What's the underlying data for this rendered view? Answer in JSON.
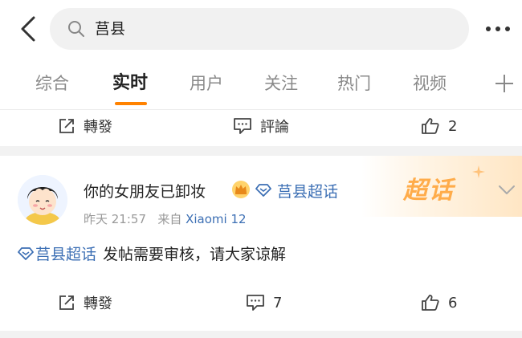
{
  "header": {
    "search_query": "莒县"
  },
  "tabs": [
    {
      "label": "综合"
    },
    {
      "label": "实时"
    },
    {
      "label": "用户"
    },
    {
      "label": "关注"
    },
    {
      "label": "热门"
    },
    {
      "label": "视频"
    }
  ],
  "active_tab": "实时",
  "accent_color": "#ff8200",
  "link_color": "#3c6fb4",
  "prev_post": {
    "repost_label": "轉發",
    "comment_label": "評論",
    "like_count": "2"
  },
  "post": {
    "banner_text": "超话",
    "username": "你的女朋友已卸妆",
    "topic_tag": "莒县超话",
    "time": "昨天 21:57",
    "source_prefix": "来自",
    "device": "Xiaomi 12",
    "content_tag": "莒县超话",
    "content_text": "发帖需要审核，请大家谅解",
    "repost_label": "轉發",
    "comment_count": "7",
    "like_count": "6"
  }
}
